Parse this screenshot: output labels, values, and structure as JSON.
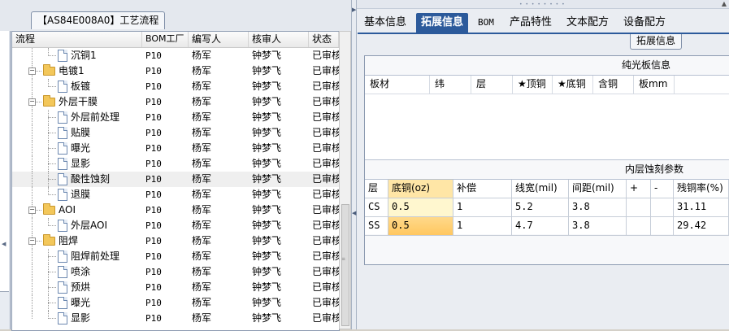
{
  "process_tab": {
    "title": "【AS84E008A0】工艺流程"
  },
  "tree": {
    "columns": [
      "流程",
      "BOM工厂",
      "编写人",
      "核审人",
      "状态"
    ],
    "rows": [
      {
        "label": "沉铜1",
        "kind": "leaf",
        "bom": "P10",
        "author": "杨军",
        "reviewer": "钟梦飞",
        "status": "已审核"
      },
      {
        "label": "电镀1",
        "kind": "folder",
        "bom": "P10",
        "author": "杨军",
        "reviewer": "钟梦飞",
        "status": "已审核"
      },
      {
        "label": "板镀",
        "kind": "leaf",
        "bom": "P10",
        "author": "杨军",
        "reviewer": "钟梦飞",
        "status": "已审核"
      },
      {
        "label": "外层干膜",
        "kind": "folder",
        "bom": "P10",
        "author": "杨军",
        "reviewer": "钟梦飞",
        "status": "已审核"
      },
      {
        "label": "外层前处理",
        "kind": "leaf",
        "bom": "P10",
        "author": "杨军",
        "reviewer": "钟梦飞",
        "status": "已审核"
      },
      {
        "label": "贴膜",
        "kind": "leaf",
        "bom": "P10",
        "author": "杨军",
        "reviewer": "钟梦飞",
        "status": "已审核"
      },
      {
        "label": "曝光",
        "kind": "leaf",
        "bom": "P10",
        "author": "杨军",
        "reviewer": "钟梦飞",
        "status": "已审核"
      },
      {
        "label": "显影",
        "kind": "leaf",
        "bom": "P10",
        "author": "杨军",
        "reviewer": "钟梦飞",
        "status": "已审核"
      },
      {
        "label": "酸性蚀刻",
        "kind": "leaf",
        "bom": "P10",
        "author": "杨军",
        "reviewer": "钟梦飞",
        "status": "已审核",
        "selected": true
      },
      {
        "label": "退膜",
        "kind": "leaf",
        "bom": "P10",
        "author": "杨军",
        "reviewer": "钟梦飞",
        "status": "已审核"
      },
      {
        "label": "AOI",
        "kind": "folder",
        "bom": "P10",
        "author": "杨军",
        "reviewer": "钟梦飞",
        "status": "已审核"
      },
      {
        "label": "外层AOI",
        "kind": "leaf",
        "bom": "P10",
        "author": "杨军",
        "reviewer": "钟梦飞",
        "status": "已审核"
      },
      {
        "label": "阻焊",
        "kind": "folder",
        "bom": "P10",
        "author": "杨军",
        "reviewer": "钟梦飞",
        "status": "已审核"
      },
      {
        "label": "阻焊前处理",
        "kind": "leaf",
        "bom": "P10",
        "author": "杨军",
        "reviewer": "钟梦飞",
        "status": "已审核"
      },
      {
        "label": "喷涂",
        "kind": "leaf",
        "bom": "P10",
        "author": "杨军",
        "reviewer": "钟梦飞",
        "status": "已审核"
      },
      {
        "label": "预烘",
        "kind": "leaf",
        "bom": "P10",
        "author": "杨军",
        "reviewer": "钟梦飞",
        "status": "已审核"
      },
      {
        "label": "曝光",
        "kind": "leaf",
        "bom": "P10",
        "author": "杨军",
        "reviewer": "钟梦飞",
        "status": "已审核"
      },
      {
        "label": "显影",
        "kind": "leaf",
        "bom": "P10",
        "author": "杨军",
        "reviewer": "钟梦飞",
        "status": "已审核"
      }
    ]
  },
  "tabs": [
    {
      "label": "基本信息",
      "active": false
    },
    {
      "label": "拓展信息",
      "active": true
    },
    {
      "label": "BOM",
      "active": false
    },
    {
      "label": "产品特性",
      "active": false
    },
    {
      "label": "文本配方",
      "active": false
    },
    {
      "label": "设备配方",
      "active": false
    }
  ],
  "sub_badge": "拓展信息",
  "section1": {
    "title": "纯光板信息",
    "columns": [
      "板材",
      "纬",
      "层",
      "★顶铜",
      "★底铜",
      "含铜",
      "板mm"
    ]
  },
  "section2": {
    "title": "内层蚀刻参数",
    "columns": [
      "层",
      "底铜(oz)",
      "补偿",
      "线宽(mil)",
      "间距(mil)",
      "+",
      "-",
      "残铜率(%)"
    ],
    "rows": [
      [
        "CS",
        "0.5",
        "1",
        "5.2",
        "3.8",
        "",
        "",
        "31.11"
      ],
      [
        "SS",
        "0.5",
        "1",
        "4.7",
        "3.8",
        "",
        "",
        "29.42"
      ]
    ]
  },
  "colors": {
    "tab_active": "#2c5a9b",
    "highlight": "#ffc760"
  }
}
